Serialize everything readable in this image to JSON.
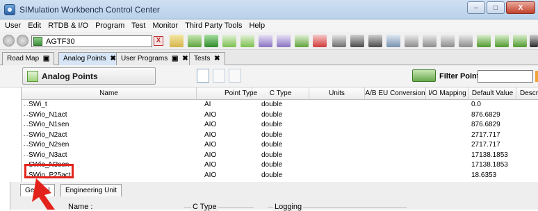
{
  "window": {
    "title": "SIMulation Workbench Control Center",
    "controls": [
      "–",
      "□",
      "X"
    ]
  },
  "menu": [
    "User",
    "Edit",
    "RTDB & I/O",
    "Program",
    "Test",
    "Monitor",
    "Third Party Tools",
    "Help"
  ],
  "toolbar": {
    "station": "AGTF30",
    "clear_label": "X"
  },
  "tabs": [
    {
      "label": "Road Map",
      "pin": "📌",
      "close": ""
    },
    {
      "label": "Analog Points",
      "pin": "",
      "close": "✖"
    },
    {
      "label": "User Programs",
      "pin": "📌",
      "close": "✖"
    },
    {
      "label": "Tests",
      "pin": "",
      "close": "✖"
    }
  ],
  "panel": {
    "title": "Analog Points",
    "filter_label": "Filter Points:",
    "filter_value": ""
  },
  "grid": {
    "columns": [
      "Name",
      "Point Type",
      "C Type",
      "Units",
      "A/B EU Conversion",
      "I/O Mapping",
      "Default Value",
      "Descri"
    ],
    "rows": [
      {
        "name": "SWi_t",
        "point_type": "AI",
        "c_type": "double",
        "default": "0.0"
      },
      {
        "name": "SWio_N1act",
        "point_type": "AIO",
        "c_type": "double",
        "default": "876.6829"
      },
      {
        "name": "SWio_N1sen",
        "point_type": "AIO",
        "c_type": "double",
        "default": "876.6829"
      },
      {
        "name": "SWio_N2act",
        "point_type": "AIO",
        "c_type": "double",
        "default": "2717.717"
      },
      {
        "name": "SWio_N2sen",
        "point_type": "AIO",
        "c_type": "double",
        "default": "2717.717"
      },
      {
        "name": "SWio_N3act",
        "point_type": "AIO",
        "c_type": "double",
        "default": "17138.1853"
      },
      {
        "name": "SWio_N3sen",
        "point_type": "AIO",
        "c_type": "double",
        "default": "17138.1853"
      },
      {
        "name": "SWio_P25act",
        "point_type": "AIO",
        "c_type": "double",
        "default": "18.6353"
      }
    ]
  },
  "bottom": {
    "tabs": [
      "General",
      "Engineering Unit"
    ],
    "name_label": "Name :",
    "ctype_label": "C Type",
    "logging_label": "Logging"
  },
  "colors": {
    "highlight": "#e3231b",
    "active_tab": "#d7e6f6"
  }
}
